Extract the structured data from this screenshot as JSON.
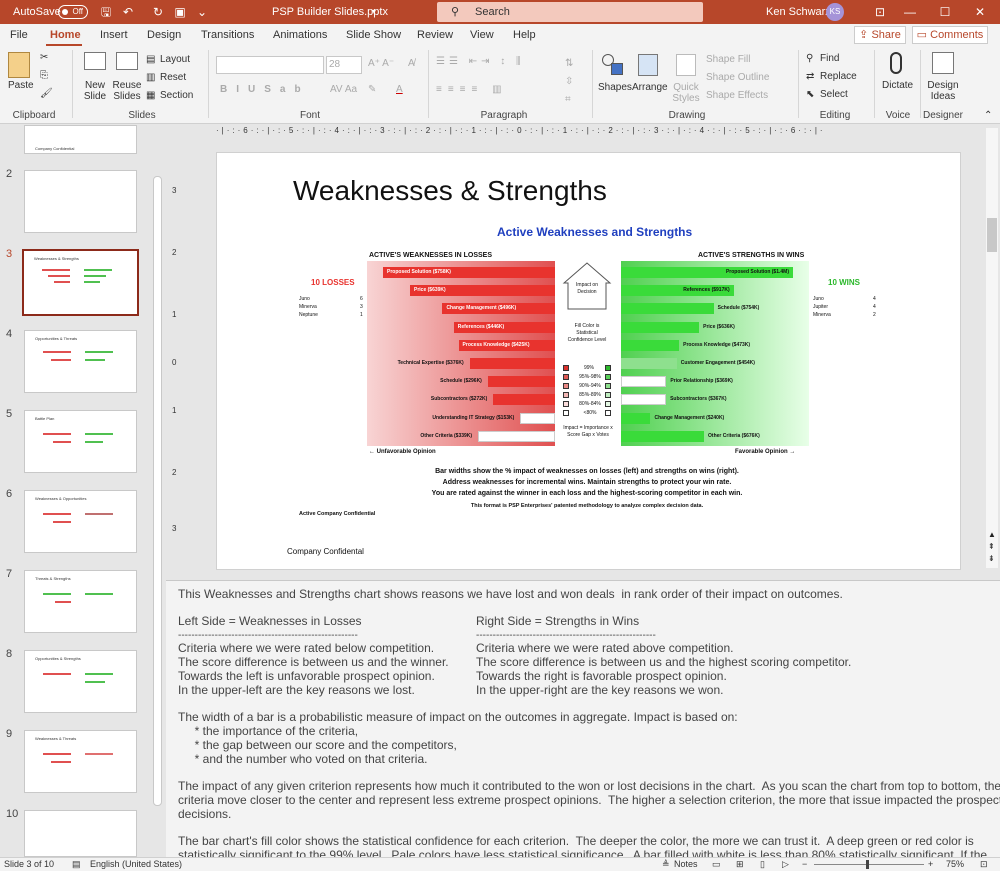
{
  "titlebar": {
    "autosave_label": "AutoSave",
    "autosave_state": "Off",
    "filename": "PSP Builder Slides.pptx",
    "search_placeholder": "Search",
    "user_name": "Ken Schwarz",
    "user_initials": "KS",
    "accent": "#b7472a"
  },
  "menu": {
    "items": [
      "File",
      "Home",
      "Insert",
      "Design",
      "Transitions",
      "Animations",
      "Slide Show",
      "Review",
      "View",
      "Help"
    ],
    "active": "Home",
    "share": "Share",
    "comments": "Comments"
  },
  "ribbon": {
    "clipboard": {
      "paste": "Paste",
      "group": "Clipboard"
    },
    "slides": {
      "new_slide": "New Slide",
      "reuse_slides": "Reuse Slides",
      "layout": "Layout",
      "reset": "Reset",
      "section": "Section",
      "group": "Slides"
    },
    "font": {
      "size": "28",
      "group": "Font"
    },
    "paragraph": {
      "group": "Paragraph"
    },
    "drawing": {
      "shapes": "Shapes",
      "arrange": "Arrange",
      "quick_styles": "Quick Styles",
      "shape_fill": "Shape Fill",
      "shape_outline": "Shape Outline",
      "shape_effects": "Shape Effects",
      "group": "Drawing"
    },
    "editing": {
      "find": "Find",
      "replace": "Replace",
      "select": "Select",
      "group": "Editing"
    },
    "voice": {
      "dictate": "Dictate",
      "group": "Voice"
    },
    "designer": {
      "design_ideas": "Design Ideas",
      "group": "Designer"
    }
  },
  "thumbnails": {
    "items": [
      {
        "num": "",
        "title": "Company Confidential"
      },
      {
        "num": "2",
        "title": ""
      },
      {
        "num": "3",
        "title": "Weaknesses & Strengths"
      },
      {
        "num": "4",
        "title": "Opportunities & Threats"
      },
      {
        "num": "5",
        "title": "Battle Plan"
      },
      {
        "num": "6",
        "title": "Weaknesses & Opportunities"
      },
      {
        "num": "7",
        "title": "Threats & Strengths"
      },
      {
        "num": "8",
        "title": "Opportunities & Strengths"
      },
      {
        "num": "9",
        "title": "Weaknesses & Threats"
      },
      {
        "num": "10",
        "title": ""
      }
    ],
    "selected_index": 2
  },
  "slide": {
    "title": "Weaknesses & Strengths",
    "chart_title": "Active Weaknesses and Strengths",
    "left_header": "ACTIVE'S WEAKNESSES IN LOSSES",
    "right_header": "ACTIVE'S STRENGTHS IN WINS",
    "losses_label": "10 LOSSES",
    "wins_label": "10 WINS",
    "loss_competitors": [
      {
        "name": "Juno",
        "count": "6"
      },
      {
        "name": "Minerva",
        "count": "3"
      },
      {
        "name": "Neptune",
        "count": "1"
      }
    ],
    "win_competitors": [
      {
        "name": "Juno",
        "count": "4"
      },
      {
        "name": "Jupiter",
        "count": "4"
      },
      {
        "name": "Minerva",
        "count": "2"
      }
    ],
    "impact_label": "Impact on Decision",
    "fill_label": "Fill Color is Statistical Confidence Level",
    "legend": [
      "99%",
      "95%-98%",
      "90%-94%",
      "85%-89%",
      "80%-84%",
      "<80%"
    ],
    "impact_formula": "Impact = Importance x Score Gap x Votes",
    "unfavorable": "← Unfavorable Opinion",
    "favorable": "Favorable Opinion →",
    "caption1": "Bar widths show the % impact of weaknesses on losses (left) and strengths on wins (right).",
    "caption2": "Address weaknesses for incremental wins. Maintain strengths to protect your win rate.",
    "caption3": "You are rated against the winner in each loss and the highest-scoring competitor in each win.",
    "caption4": "This format is PSP Enterprises' patented methodology to analyze complex decision data.",
    "confidential": "Active Company Confidential",
    "footer": "Company Confidental",
    "colors": {
      "loss": "#e8332e",
      "win": "#3adb3a",
      "title_blue": "#1f3fbf"
    }
  },
  "chart_data": [
    {
      "type": "bar",
      "title": "ACTIVE'S WEAKNESSES IN LOSSES",
      "categories": [
        "Proposed Solution ($758K)",
        "Price ($639K)",
        "Change Management ($496K)",
        "References ($446K)",
        "Process Knowledge ($425K)",
        "Technical Expertise ($376K)",
        "Schedule ($296K)",
        "Subcontractors ($272K)",
        "Understanding IT Strategy ($153K)",
        "Other Criteria ($339K)"
      ],
      "values": [
        758,
        639,
        496,
        446,
        425,
        376,
        296,
        272,
        153,
        339
      ]
    },
    {
      "type": "bar",
      "title": "ACTIVE'S STRENGTHS IN WINS",
      "categories": [
        "Proposed Solution ($1.4M)",
        "References ($917K)",
        "Schedule ($754K)",
        "Price ($636K)",
        "Process Knowledge ($473K)",
        "Customer Engagement ($454K)",
        "Prior Relationship ($369K)",
        "Subcontractors ($367K)",
        "Change Management ($240K)",
        "Other Criteria ($676K)"
      ],
      "values": [
        1400,
        917,
        754,
        636,
        473,
        454,
        369,
        367,
        240,
        676
      ]
    }
  ],
  "notes": {
    "p1": "This Weaknesses and Strengths chart shows reasons we have lost and won deals  in rank order of their impact on outcomes.",
    "left_head": "Left Side = Weaknesses in Losses",
    "right_head": "Right Side = Strengths in Wins",
    "dashes": "------------------------------------------------------",
    "left_lines": [
      "Criteria where we were rated below competition.",
      "The score difference is between us and the winner.",
      "Towards the left is unfavorable prospect opinion.",
      "In the upper-left are the key reasons we lost."
    ],
    "right_lines": [
      "Criteria where we were rated above competition.",
      "The score difference is between us and the highest scoring competitor.",
      "Towards the right is favorable prospect opinion.",
      "In the upper-right are the key reasons we won."
    ],
    "p3": "The width of a bar is a probabilistic measure of impact on the outcomes in aggregate. Impact is based on:",
    "bullets": [
      "     * the importance of the criteria,",
      "     * the gap between our score and the competitors,",
      "     * and the number who voted on that criteria."
    ],
    "p4a": "The impact of any given criterion represents how much it contributed to the won or lost decisions in the chart.  As you scan the chart from top to bottom, the",
    "p4b": "criteria move closer to the center and represent less extreme prospect opinions.  The higher a selection criterion, the more that issue impacted the prospects'",
    "p4c": "decisions.",
    "p5a": "The bar chart's fill color shows the statistical confidence for each criterion.  The deeper the color, the more we can trust it.  A deep green or red color is",
    "p5b": "statistically significant to the 99% level.  Pale colors have less statistical significance.  A bar filled with white is less than 80% statistically significant. If the"
  },
  "status": {
    "slide_info": "Slide 3 of 10",
    "language": "English (United States)",
    "notes": "Notes",
    "zoom": "75%"
  }
}
